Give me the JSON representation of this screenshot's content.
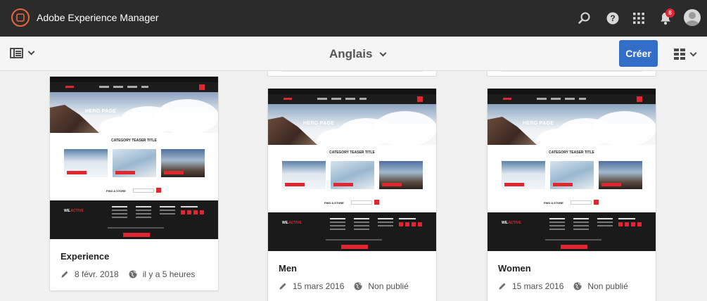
{
  "shell": {
    "app_title": "Adobe Experience Manager",
    "notification_count": "8",
    "icons": [
      "adobe-logo-icon",
      "search-icon",
      "help-icon",
      "solutions-grid-icon",
      "bell-icon",
      "user-avatar"
    ]
  },
  "actionbar": {
    "title": "Anglais",
    "create_label": "Créer",
    "accent_color": "#326ec8"
  },
  "cards": [
    {
      "title": "Experience",
      "modified": "8 févr. 2018",
      "published": "il y a 5 heures",
      "thumb": {
        "hero_text": "HERO PAGE",
        "section_title": "CATEGORY TEASER TITLE",
        "find_title": "FIND A STORE",
        "logo": "WE.",
        "logo_accent": "ACTIVE"
      }
    },
    {
      "title": "Men",
      "modified": "15 mars 2016",
      "published": "Non publié",
      "thumb": {
        "hero_text": "HERO PAGE",
        "section_title": "CATEGORY TEASER TITLE",
        "find_title": "FIND A STORE",
        "logo": "WE.",
        "logo_accent": "ACTIVE"
      }
    },
    {
      "title": "Women",
      "modified": "15 mars 2016",
      "published": "Non publié",
      "thumb": {
        "hero_text": "HERO PAGE",
        "section_title": "CATEGORY TEASER TITLE",
        "find_title": "FIND A STORE",
        "logo": "WE.",
        "logo_accent": "ACTIVE"
      }
    }
  ]
}
